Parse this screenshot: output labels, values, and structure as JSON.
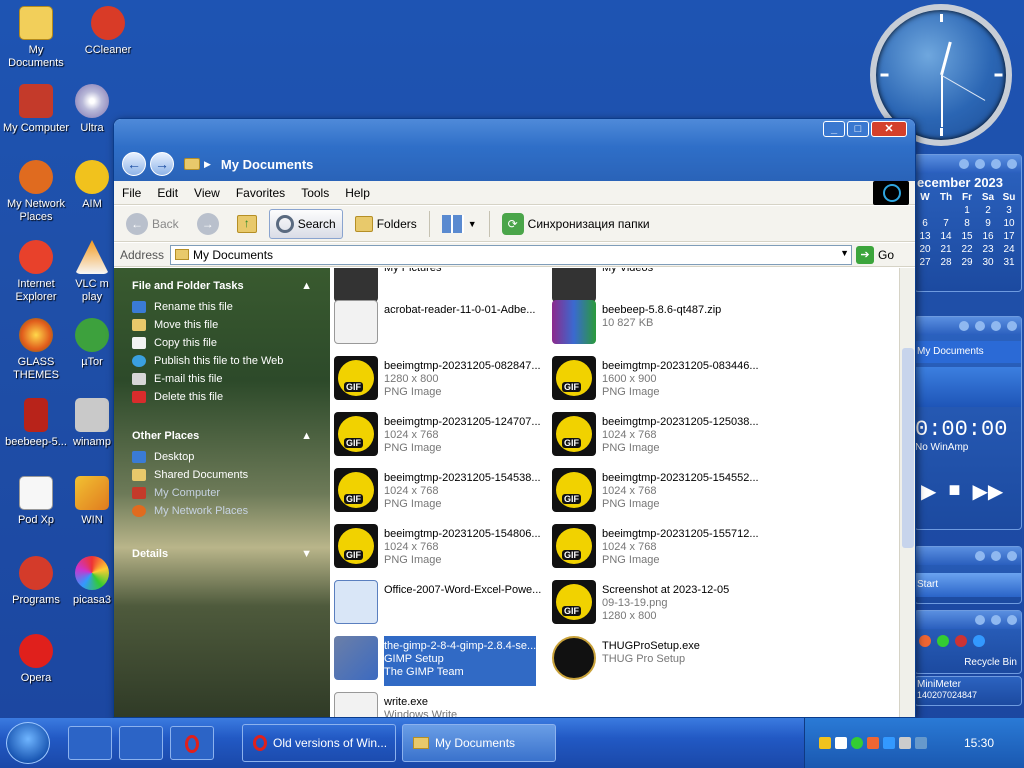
{
  "desktop": {
    "icons": [
      {
        "label": "My\nDocuments"
      },
      {
        "label": "CCleaner"
      },
      {
        "label": "My Computer"
      },
      {
        "label": "Ultra"
      },
      {
        "label": "My Network\nPlaces"
      },
      {
        "label": "AIM"
      },
      {
        "label": "Internet\nExplorer"
      },
      {
        "label": "VLC m\nplay"
      },
      {
        "label": "GLASS\nTHEMES"
      },
      {
        "label": "µTor"
      },
      {
        "label": "beebeep-5..."
      },
      {
        "label": "winamp"
      },
      {
        "label": "Pod Xp"
      },
      {
        "label": "WIN"
      },
      {
        "label": "Programs"
      },
      {
        "label": "picasa3"
      },
      {
        "label": "Opera"
      }
    ]
  },
  "calendar": {
    "title": "ecember 2023",
    "headers": [
      "W",
      "Th",
      "Fr",
      "Sa",
      "Su"
    ],
    "rows": [
      [
        "",
        "",
        "1",
        "2",
        "3"
      ],
      [
        "6",
        "7",
        "8",
        "9",
        "10"
      ],
      [
        "13",
        "14",
        "15",
        "16",
        "17"
      ],
      [
        "20",
        "21",
        "22",
        "23",
        "24"
      ],
      [
        "27",
        "28",
        "29",
        "30",
        "31"
      ]
    ]
  },
  "winamp_gadget": {
    "title": "My Documents",
    "time": "0:00:00",
    "status": "No WinAmp"
  },
  "start_gadget": {
    "label": "Start"
  },
  "recycle": {
    "label": "Recycle Bin"
  },
  "minimeter": {
    "title": "MiniMeter",
    "value": "140207024847"
  },
  "window": {
    "title": "My Documents",
    "menu": [
      "File",
      "Edit",
      "View",
      "Favorites",
      "Tools",
      "Help"
    ],
    "toolbar": {
      "back": "Back",
      "search": "Search",
      "folders": "Folders",
      "sync": "Синхронизация папки"
    },
    "address": {
      "label": "Address",
      "value": "My Documents",
      "go": "Go"
    },
    "tasks": {
      "file_tasks_title": "File and Folder Tasks",
      "file_tasks": [
        "Rename this file",
        "Move this file",
        "Copy this file",
        "Publish this file to the Web",
        "E-mail this file",
        "Delete this file"
      ],
      "other_places_title": "Other Places",
      "other_places": [
        "Desktop",
        "Shared Documents",
        "My Computer",
        "My Network Places"
      ],
      "details_title": "Details"
    },
    "files": [
      {
        "name": "My Pictures",
        "line2": "",
        "line3": "",
        "icon": "camera-folder-icon"
      },
      {
        "name": "My Videos",
        "line2": "",
        "line3": "",
        "icon": "video-folder-icon"
      },
      {
        "name": "acrobat-reader-11-0-01-Adbe...",
        "line2": "",
        "line3": "",
        "icon": "terminal-icon"
      },
      {
        "name": "beebeep-5.8.6-qt487.zip",
        "line2": "10 827 KB",
        "line3": "",
        "icon": "zip-icon"
      },
      {
        "name": "beeimgtmp-20231205-082847...",
        "line2": "1280 x 800",
        "line3": "PNG Image",
        "icon": "gif-icon"
      },
      {
        "name": "beeimgtmp-20231205-083446...",
        "line2": "1600 x 900",
        "line3": "PNG Image",
        "icon": "gif-icon"
      },
      {
        "name": "beeimgtmp-20231205-124707...",
        "line2": "1024 x 768",
        "line3": "PNG Image",
        "icon": "gif-icon"
      },
      {
        "name": "beeimgtmp-20231205-125038...",
        "line2": "1024 x 768",
        "line3": "PNG Image",
        "icon": "gif-icon"
      },
      {
        "name": "beeimgtmp-20231205-154538...",
        "line2": "1024 x 768",
        "line3": "PNG Image",
        "icon": "gif-icon"
      },
      {
        "name": "beeimgtmp-20231205-154552...",
        "line2": "1024 x 768",
        "line3": "PNG Image",
        "icon": "gif-icon"
      },
      {
        "name": "beeimgtmp-20231205-154806...",
        "line2": "1024 x 768",
        "line3": "PNG Image",
        "icon": "gif-icon"
      },
      {
        "name": "beeimgtmp-20231205-155712...",
        "line2": "1024 x 768",
        "line3": "PNG Image",
        "icon": "gif-icon"
      },
      {
        "name": "Office-2007-Word-Excel-Powe...",
        "line2": "",
        "line3": "",
        "icon": "office-icon"
      },
      {
        "name": "Screenshot at 2023-12-05",
        "line2": "09-13-19.png",
        "line3": "1280 x 800",
        "icon": "gif-icon"
      },
      {
        "name": "the-gimp-2-8-4-gimp-2.8.4-se...",
        "line2": "GIMP Setup",
        "line3": "The GIMP Team",
        "icon": "gimp-setup-icon",
        "selected": true
      },
      {
        "name": "THUGProSetup.exe",
        "line2": "THUG Pro Setup",
        "line3": "",
        "icon": "thug-icon"
      },
      {
        "name": "write.exe",
        "line2": "Windows Write",
        "line3": "",
        "icon": "write-icon"
      }
    ]
  },
  "taskbar": {
    "tasks": [
      {
        "label": "Old versions of Win..."
      },
      {
        "label": "My Documents"
      }
    ],
    "time": "15:30"
  }
}
